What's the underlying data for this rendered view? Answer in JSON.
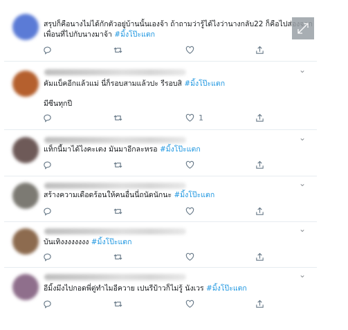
{
  "tweets": [
    {
      "text": "สรุปก็คือนางไม่ได้กักตัวอยู่บ้านนั้นเองจ้า ถ้าถามว่ารู้ได้ไงว่านางกลับ22 ก็คือไปส่องจากเพื่อนที่ไปกับนางมาจ้า",
      "hashtag": "#มิ้งโป๊ะแตก",
      "extra": "",
      "like_count": "",
      "avatar_color": "#5b7bd6"
    },
    {
      "text": "คัมแบ็คอีกแล้วแม่ นี่ก็รอบสามแล้วปะ รีรอบสิ",
      "hashtag": "#มิ้งโป๊ะแตก",
      "extra": "มีซีนทุกปี",
      "like_count": "1",
      "avatar_color": "#b5602e"
    },
    {
      "text": "แท็กนี้มาได้ไงคะเตง มันมาอีกละหรอ",
      "hashtag": "#มิ้งโป๊ะแตก",
      "extra": "",
      "like_count": "",
      "avatar_color": "#6e5a58"
    },
    {
      "text": "สร้างความเดือดร้อนให้คนอื่นนี่ถนัดนักนะ",
      "hashtag": "#มิ้งโป๊ะแตก",
      "extra": "",
      "like_count": "",
      "avatar_color": "#7c7a73"
    },
    {
      "text": "บันเทิงงงงงงงง",
      "hashtag": "#มิ้งโป๊ะแตก",
      "extra": "",
      "like_count": "",
      "avatar_color": "#8d6b4f"
    },
    {
      "text": "อีมิ้งมึงไปกอดพี่ตู่ทำไมอีควาย เปนรีป้าวก็ไม่รู้ นังเวร",
      "hashtag": "#มิ้งโป๊ะแตก",
      "extra": "",
      "like_count": "",
      "avatar_color": "#8f6f8c"
    }
  ],
  "icons": {
    "reply": "reply-icon",
    "retweet": "retweet-icon",
    "like": "heart-icon",
    "share": "share-icon",
    "more": "chevron-down-icon",
    "expand": "expand-icon"
  },
  "colors": {
    "hashtag": "#1b95e0",
    "icon": "#657786"
  }
}
